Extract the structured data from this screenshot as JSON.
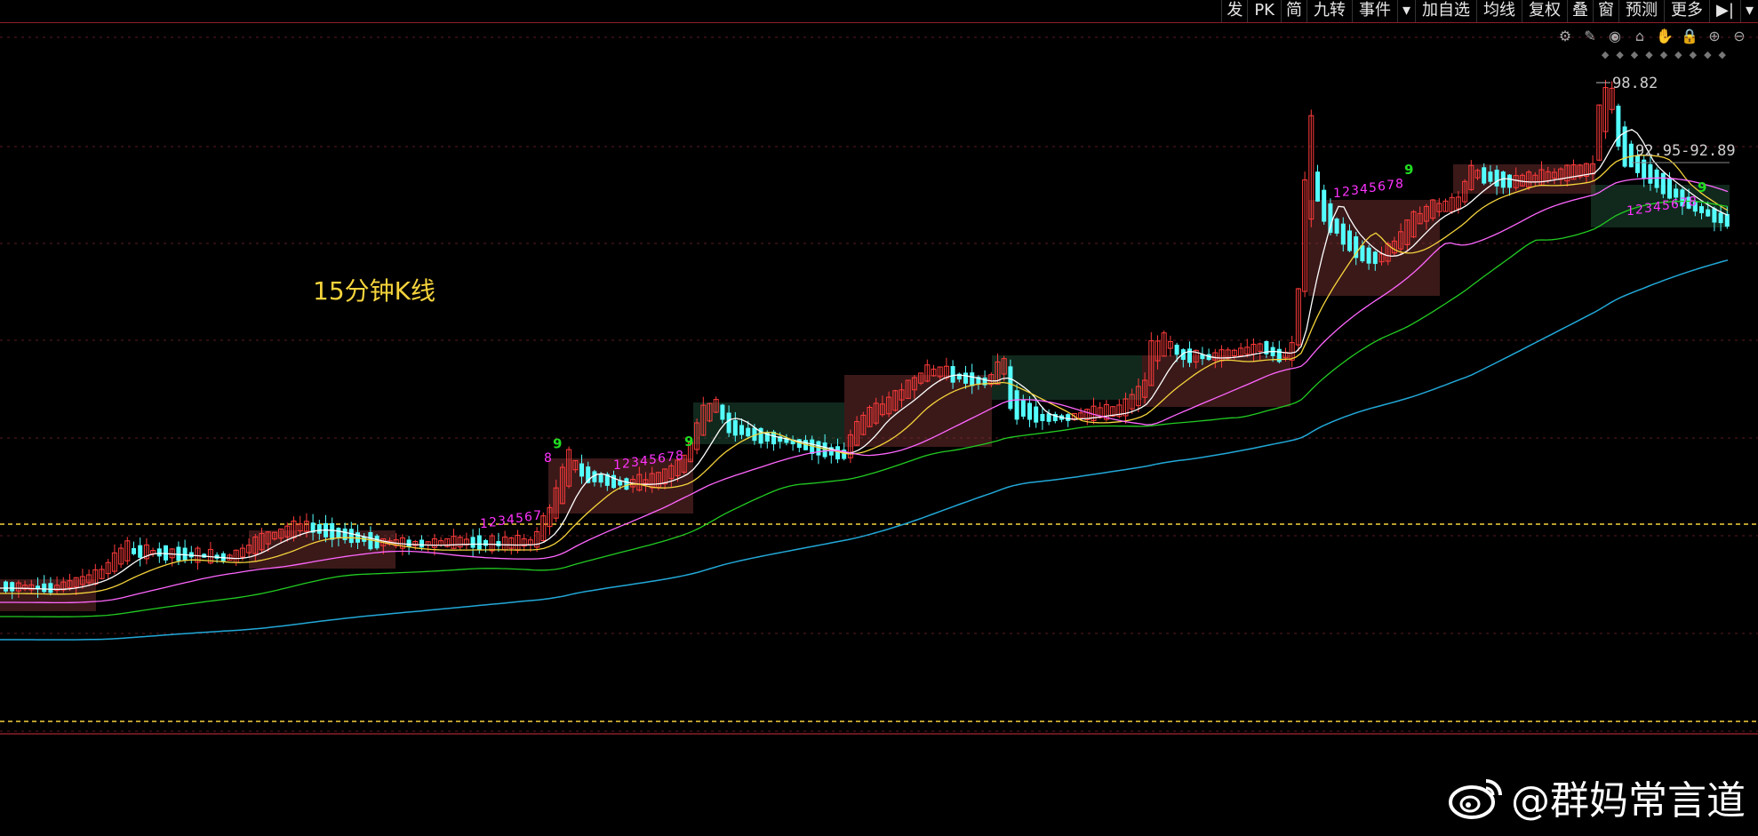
{
  "toolbar": {
    "items": [
      "发",
      "PK",
      "简",
      "九转",
      "事件",
      "▾",
      "加自选",
      "均线",
      "复权",
      "叠",
      "窗",
      "预测",
      "更多",
      "▶|",
      "▾"
    ]
  },
  "icons": [
    "settings-icon",
    "pen-icon",
    "eye-icon",
    "basket-icon",
    "hand-icon",
    "lock-icon",
    "zoom-in-icon",
    "zoom-out-icon"
  ],
  "period_label": "15分钟K线",
  "watermark": "@群妈常言道",
  "chart_data": {
    "type": "candlestick",
    "high_label": "98.82",
    "range_label": "92.95-92.89",
    "colors": {
      "up": "#ff3b3b",
      "down": "#54ffff",
      "ma5": "#ffffff",
      "ma10": "#f5d33c",
      "ma20": "#ff66ff",
      "ma30": "#22cc22",
      "ma60": "#22a8d8",
      "td": "#ff33ff",
      "td9": "#22dd22"
    },
    "td_sequences": [
      {
        "labels": [
          "1",
          "2",
          "3",
          "4",
          "5",
          "6",
          "7"
        ],
        "nine": ""
      },
      {
        "labels": [
          "8"
        ],
        "nine": "9"
      },
      {
        "labels": [
          "1",
          "2",
          "3",
          "4",
          "5",
          "6",
          "7",
          "8"
        ],
        "nine": "9"
      },
      {
        "labels": [
          "1",
          "2",
          "3",
          "4",
          "5",
          "6",
          "7",
          "8"
        ],
        "nine": "9"
      },
      {
        "labels": [
          "1",
          "2",
          "3",
          "4",
          "5",
          "6",
          "7",
          "8"
        ],
        "nine": "9"
      }
    ]
  }
}
